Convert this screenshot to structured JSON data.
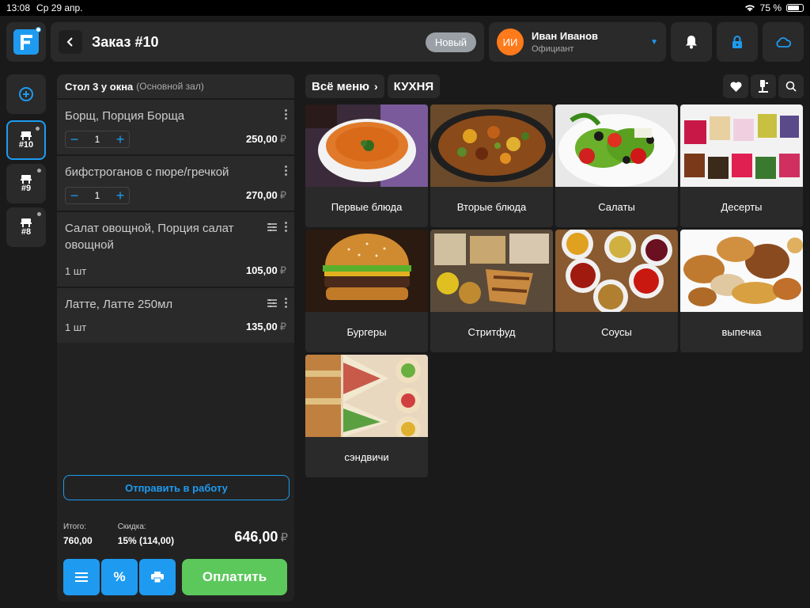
{
  "status_bar": {
    "time": "13:08",
    "date": "Ср 29 апр.",
    "battery": "75 %",
    "battery_level": 0.75
  },
  "header": {
    "order_title": "Заказ #10",
    "status_badge": "Новый",
    "user": {
      "initials": "ИИ",
      "name": "Иван Иванов",
      "role": "Официант"
    }
  },
  "rail": {
    "tables": [
      {
        "label": "#10",
        "active": true
      },
      {
        "label": "#9",
        "active": false
      },
      {
        "label": "#8",
        "active": false
      }
    ]
  },
  "order": {
    "table": "Стол 3 у окна",
    "zone": "(Основной зал)",
    "items": [
      {
        "name": "Борщ, Порция Борща",
        "qty": "1",
        "price": "250,00",
        "stepper": true,
        "modifiers": false
      },
      {
        "name": "бифстроганов с пюре/гречкой",
        "qty": "1",
        "price": "270,00",
        "stepper": true,
        "modifiers": false
      },
      {
        "name": "Салат овощной, Порция салат овощной",
        "qty": "1 шт",
        "price": "105,00",
        "stepper": false,
        "modifiers": true
      },
      {
        "name": "Латте, Латте 250мл",
        "qty": "1 шт",
        "price": "135,00",
        "stepper": false,
        "modifiers": true
      }
    ],
    "currency": "₽",
    "send_button": "Отправить в работу",
    "totals": {
      "subtotal_label": "Итого:",
      "subtotal": "760,00",
      "discount_label": "Скидка:",
      "discount": "15% (114,00)",
      "grand_total": "646,00"
    },
    "pay_button": "Оплатить"
  },
  "menu": {
    "breadcrumb_root": "Всё меню",
    "breadcrumb_current": "КУХНЯ",
    "categories": [
      {
        "name": "Первые блюда",
        "icon": "soup"
      },
      {
        "name": "Вторые блюда",
        "icon": "stew"
      },
      {
        "name": "Салаты",
        "icon": "salad"
      },
      {
        "name": "Десерты",
        "icon": "dessert"
      },
      {
        "name": "Бургеры",
        "icon": "burger"
      },
      {
        "name": "Стритфуд",
        "icon": "streetfood"
      },
      {
        "name": "Соусы",
        "icon": "sauces"
      },
      {
        "name": "выпечка",
        "icon": "pastry"
      },
      {
        "name": "сэндвичи",
        "icon": "sandwich"
      }
    ]
  },
  "colors": {
    "accent": "#1e9bf0",
    "pay": "#5cc85c",
    "avatar": "#ff7a1a",
    "badge": "#9aa0a6"
  }
}
